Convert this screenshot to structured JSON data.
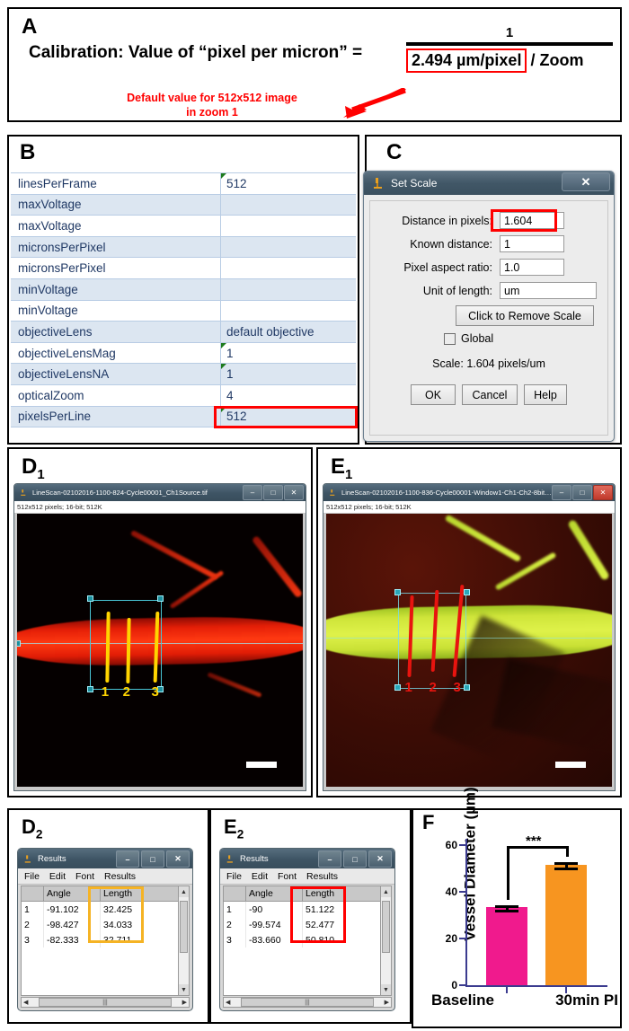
{
  "panelA": {
    "label": "A",
    "calibration_text": "Calibration: Value of “pixel per micron” =",
    "numerator": "1",
    "denominator_boxed": "2.494 µm/pixel",
    "denominator_rest": "/ Zoom",
    "note_line1": "Default value for 512x512 image",
    "note_line2": "in zoom 1",
    "note_color": "#ff0000",
    "highlight_color": "#ff0000"
  },
  "panelB": {
    "label": "B",
    "highlight_color": "#ff0000",
    "highlight_row": "opticalZoom",
    "rows": [
      {
        "key": "linesPerFrame",
        "value": "512",
        "marker": true
      },
      {
        "key": "maxVoltage",
        "value": "",
        "marker": false
      },
      {
        "key": "maxVoltage",
        "value": "",
        "marker": false
      },
      {
        "key": "micronsPerPixel",
        "value": "",
        "marker": false
      },
      {
        "key": "micronsPerPixel",
        "value": "",
        "marker": false
      },
      {
        "key": "minVoltage",
        "value": "",
        "marker": false
      },
      {
        "key": "minVoltage",
        "value": "",
        "marker": false
      },
      {
        "key": "objectiveLens",
        "value": "default objective",
        "marker": false
      },
      {
        "key": "objectiveLensMag",
        "value": "1",
        "marker": true
      },
      {
        "key": "objectiveLensNA",
        "value": "1",
        "marker": true
      },
      {
        "key": "opticalZoom",
        "value": "4",
        "marker": false
      },
      {
        "key": "pixelsPerLine",
        "value": "512",
        "marker": true
      }
    ]
  },
  "panelC": {
    "label": "C",
    "window_title": "Set Scale",
    "close_label": "✕",
    "fields": [
      {
        "label": "Distance in pixels:",
        "value": "1.604",
        "highlighted": true
      },
      {
        "label": "Known distance:",
        "value": "1",
        "highlighted": false
      },
      {
        "label": "Pixel aspect ratio:",
        "value": "1.0",
        "highlighted": false
      },
      {
        "label": "Unit of length:",
        "value": "um",
        "highlighted": false
      }
    ],
    "remove_scale_button": "Click to Remove Scale",
    "global_label": "Global",
    "scale_text": "Scale: 1.604 pixels/um",
    "buttons": [
      "OK",
      "Cancel",
      "Help"
    ],
    "highlight_color": "#ff0000"
  },
  "panelD1": {
    "label": "D",
    "sublabel": "1",
    "window_title": "LineScan-02102016-1100-824-Cycle00001_Ch1Source.tif",
    "info_bar": "512x512 pixels; 16-bit; 512K",
    "window_buttons": [
      "–",
      "□",
      "✕"
    ],
    "line_color": "#ffd400",
    "measurement_numbers": [
      "1",
      "2",
      "3"
    ],
    "roi_color": "#49c6d6"
  },
  "panelE1": {
    "label": "E",
    "sublabel": "1",
    "window_title": "LineScan-02102016-1100-836-Cycle00001-Window1-Ch1-Ch2-8bit-Refer...",
    "info_bar": "512x512 pixels; 16-bit; 512K",
    "window_buttons": [
      "–",
      "□",
      "✕"
    ],
    "line_color": "#e8140f",
    "measurement_numbers": [
      "1",
      "2",
      "3"
    ],
    "roi_color": "#49c6d6"
  },
  "panelD2": {
    "label": "D",
    "sublabel": "2",
    "window_title": "Results",
    "window_buttons": [
      "–",
      "□",
      "✕"
    ],
    "menu": [
      "File",
      "Edit",
      "Font",
      "Results"
    ],
    "columns": [
      "",
      "Angle",
      "Length",
      ""
    ],
    "rows": [
      {
        "index": "1",
        "angle": "-91.102",
        "length": "32.425"
      },
      {
        "index": "2",
        "angle": "-98.427",
        "length": "34.033"
      },
      {
        "index": "3",
        "angle": "-82.333",
        "length": "32.711"
      }
    ],
    "highlight_color": "#f5b324"
  },
  "panelE2": {
    "label": "E",
    "sublabel": "2",
    "window_title": "Results",
    "window_buttons": [
      "–",
      "□",
      "✕"
    ],
    "menu": [
      "File",
      "Edit",
      "Font",
      "Results"
    ],
    "columns": [
      "",
      "Angle",
      "Length",
      ""
    ],
    "rows": [
      {
        "index": "1",
        "angle": "-90",
        "length": "51.122"
      },
      {
        "index": "2",
        "angle": "-99.574",
        "length": "52.477"
      },
      {
        "index": "3",
        "angle": "-83.660",
        "length": "50.810"
      }
    ],
    "highlight_color": "#ff0000"
  },
  "panelF": {
    "label": "F",
    "significance": "***"
  },
  "chart_data": {
    "type": "bar",
    "title": "",
    "xlabel": "",
    "ylabel": "Vessel Diameter (µm)",
    "categories": [
      "Baseline",
      "30min PI"
    ],
    "values": [
      33.4,
      51.5
    ],
    "errors": [
      0.9,
      1.1
    ],
    "colors": [
      "#f01a8d",
      "#f79520"
    ],
    "ylim": [
      0,
      62
    ],
    "yticks": [
      0,
      20,
      40,
      60
    ],
    "ytick_labels": [
      "0",
      "20",
      "40",
      "60"
    ],
    "axis_color": "#3b3b8f",
    "grid": false,
    "legend": false,
    "annotations": [
      {
        "text": "***",
        "between": [
          "Baseline",
          "30min PI"
        ],
        "type": "significance-bracket"
      }
    ]
  }
}
